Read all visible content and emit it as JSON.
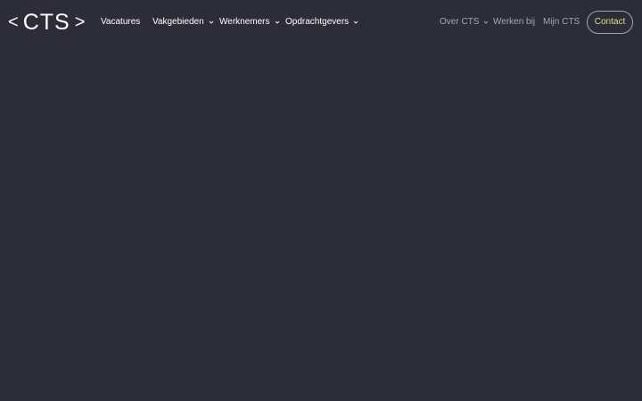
{
  "logo": {
    "left_bracket": "<",
    "text": "CTS",
    "right_bracket": ">"
  },
  "nav": {
    "primary": [
      {
        "label": "Vacatures",
        "has_dropdown": false
      },
      {
        "label": "Vakgebieden",
        "has_dropdown": true
      },
      {
        "label": "Werknemers",
        "has_dropdown": true
      },
      {
        "label": "Opdrachtgevers",
        "has_dropdown": true
      }
    ],
    "secondary": [
      {
        "label": "Over CTS",
        "has_dropdown": true
      },
      {
        "label": "Werken bij",
        "has_dropdown": false
      },
      {
        "label": "Mijn CTS",
        "has_dropdown": false
      }
    ],
    "cta": {
      "label": "Contact"
    }
  },
  "icons": {
    "dropdown": "chevron-down-icon"
  },
  "colors": {
    "background": "#2c2d38",
    "primary_text": "#ffffff",
    "secondary_text": "#a5a7b2",
    "cta_text": "#d4e47a",
    "cta_border": "#a2a4ad"
  }
}
